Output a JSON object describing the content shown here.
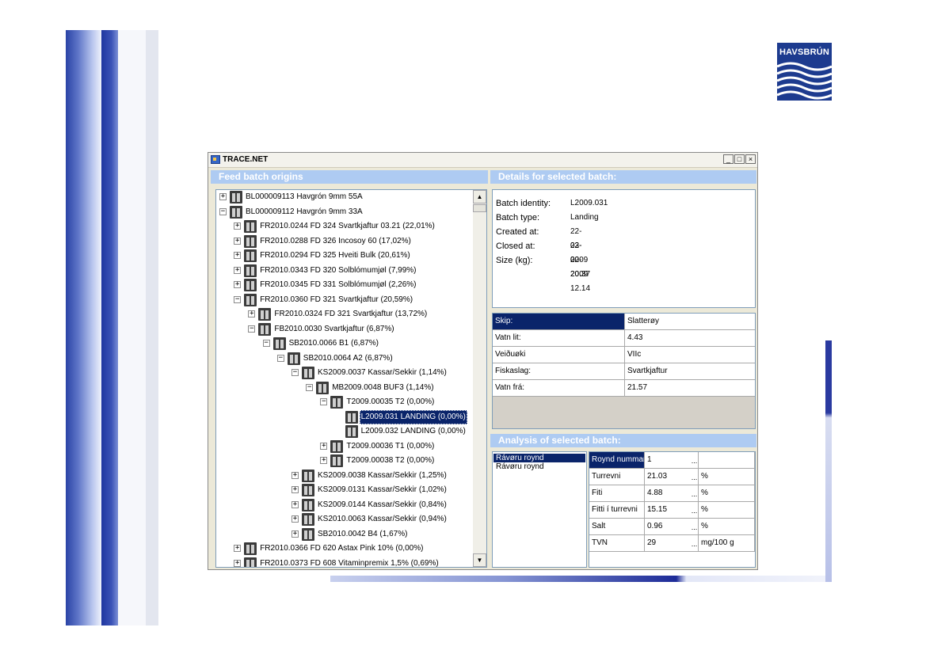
{
  "logo": {
    "text": "HAVSBRÚN",
    "color": "#1d3b8f"
  },
  "window": {
    "title": "TRACE.NET",
    "controls": [
      "_",
      "□",
      "×"
    ]
  },
  "headers": {
    "origins": "Feed batch origins",
    "details": "Details for selected batch:",
    "analysis": "Analysis of selected batch:"
  },
  "tree": [
    {
      "label": "BL000009113  Havgrón 9mm 55A",
      "expander": "+"
    },
    {
      "label": "BL000009112  Havgrón 9mm 33A",
      "expander": "−"
    },
    {
      "label": "FR2010.0244  FD 324  Svartkjaftur 03.21 (22,01%)",
      "expander": "+"
    },
    {
      "label": "FR2010.0288  FD 326  Incosoy 60 (17,02%)",
      "expander": "+"
    },
    {
      "label": "FR2010.0294  FD 325  Hveiti Bulk (20,61%)",
      "expander": "+"
    },
    {
      "label": "FR2010.0343  FD 320  Solblómumjøl (7,99%)",
      "expander": "+"
    },
    {
      "label": "FR2010.0345  FD 331  Solblómumjøl (2,26%)",
      "expander": "+"
    },
    {
      "label": "FR2010.0360  FD 321  Svartkjaftur (20,59%)",
      "expander": "−"
    },
    {
      "label": "FR2010.0324  FD 321  Svartkjaftur (13,72%)",
      "expander": "+"
    },
    {
      "label": "FB2010.0030  Svartkjaftur (6,87%)",
      "expander": "−"
    },
    {
      "label": "SB2010.0066  B1 (6,87%)",
      "expander": "−"
    },
    {
      "label": "SB2010.0064  A2 (6,87%)",
      "expander": "−"
    },
    {
      "label": "KS2009.0037  Kassar/Sekkir (1,14%)",
      "expander": "−"
    },
    {
      "label": "MB2009.0048  BUF3 (1,14%)",
      "expander": "−"
    },
    {
      "label": "T2009.00035  T2 (0,00%)",
      "expander": "−"
    },
    {
      "label": "L2009.031  LANDING (0,00%)",
      "expander": ""
    },
    {
      "label": "L2009.032  LANDING (0,00%)",
      "expander": ""
    },
    {
      "label": "T2009.00036  T1 (0,00%)",
      "expander": "+"
    },
    {
      "label": "T2009.00038  T2 (0,00%)",
      "expander": "+"
    },
    {
      "label": "KS2009.0038  Kassar/Sekkir (1,25%)",
      "expander": "+"
    },
    {
      "label": "KS2009.0131  Kassar/Sekkir (1,02%)",
      "expander": "+"
    },
    {
      "label": "KS2009.0144  Kassar/Sekkir (0,84%)",
      "expander": "+"
    },
    {
      "label": "KS2010.0063  Kassar/Sekkir (0,94%)",
      "expander": "+"
    },
    {
      "label": "SB2010.0042  B4 (1,67%)",
      "expander": "+"
    },
    {
      "label": "FR2010.0366  FD 620  Astax Pink 10% (0,00%)",
      "expander": "+"
    },
    {
      "label": "FR2010.0373  FD 608  Vitaminpremix 1,5% (0,69%)",
      "expander": "+"
    }
  ],
  "details": {
    "batch_identity": {
      "label": "Batch identity:",
      "value": "L2009.031"
    },
    "batch_type": {
      "label": "Batch type:",
      "value": "Landing"
    },
    "created_at": {
      "label": "Created at:",
      "value": "22-02-2009 20.37"
    },
    "closed_at": {
      "label": "Closed at:",
      "value": "23-02-2009 12.14"
    },
    "size": {
      "label": "Size (kg):",
      "value": "0"
    }
  },
  "properties": [
    {
      "key": "Skip:",
      "value": "Slatterøy"
    },
    {
      "key": "Vatn lit:",
      "value": "4.43"
    },
    {
      "key": "Veiðuøki",
      "value": "VIIc"
    },
    {
      "key": "Fiskaslag:",
      "value": "Svartkjaftur"
    },
    {
      "key": "Vatn frá:",
      "value": "21.57"
    }
  ],
  "analysis_list": [
    "Rávøru roynd",
    "Rávøru roynd"
  ],
  "analysis_table": [
    {
      "name": "Roynd nummar",
      "value": "1",
      "unit": ""
    },
    {
      "name": "Turrevni",
      "value": "21.03",
      "unit": "%"
    },
    {
      "name": "Fiti",
      "value": "4.88",
      "unit": "%"
    },
    {
      "name": "Fitti í turrevni",
      "value": "15.15",
      "unit": "%"
    },
    {
      "name": "Salt",
      "value": "0.96",
      "unit": "%"
    },
    {
      "name": "TVN",
      "value": "29",
      "unit": "mg/100 g"
    }
  ],
  "ellipsis": "..."
}
